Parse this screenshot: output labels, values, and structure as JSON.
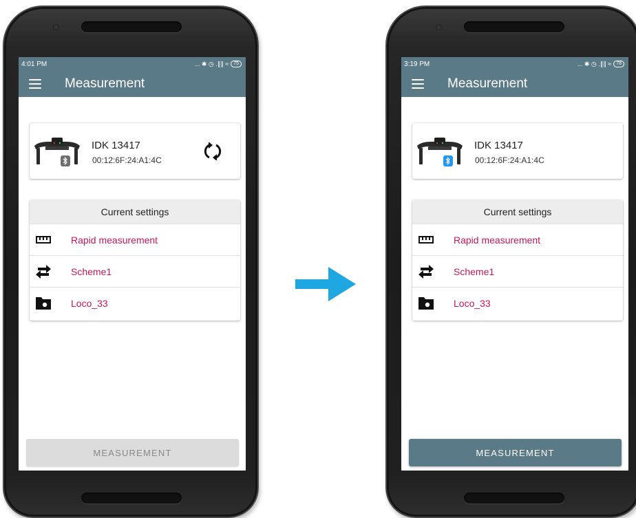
{
  "colors": {
    "appbar": "#5b7a87",
    "accent_text": "#c2185b",
    "arrow": "#1ea7e1",
    "bluetooth_inactive": "#6f6f6f",
    "bluetooth_active": "#2196f3",
    "button_disabled": "#dcdcdc",
    "button_enabled": "#5b7a87"
  },
  "arrow": {
    "icon": "right-arrow-icon",
    "meaning": ""
  },
  "phones": [
    {
      "state": "disconnected",
      "status_bar": {
        "time": "4:01 PM",
        "battery": "75",
        "icons": "... ✱ ◷ .∥∥ ≈"
      },
      "app_bar": {
        "title": "Measurement",
        "menu_icon": "hamburger-menu-icon"
      },
      "device": {
        "name": "IDK 13417",
        "mac": "00:12:6F:24:A1:4C",
        "bluetooth_connected": false,
        "show_refresh": true
      },
      "settings": {
        "header": "Current settings",
        "items": [
          {
            "label": "Rapid measurement",
            "icon": "ruler-icon"
          },
          {
            "label": "Scheme1",
            "icon": "swap-arrows-icon"
          },
          {
            "label": "Loco_33",
            "icon": "folder-camera-icon"
          }
        ]
      },
      "button": {
        "label": "MEASUREMENT",
        "enabled": false
      }
    },
    {
      "state": "connected",
      "status_bar": {
        "time": "3:19 PM",
        "battery": "78",
        "icons": "... ✱ ◷ .∥∥ ≈"
      },
      "app_bar": {
        "title": "Measurement",
        "menu_icon": "hamburger-menu-icon"
      },
      "device": {
        "name": "IDK 13417",
        "mac": "00:12:6F:24:A1:4C",
        "bluetooth_connected": true,
        "show_refresh": false
      },
      "settings": {
        "header": "Current settings",
        "items": [
          {
            "label": "Rapid measurement",
            "icon": "ruler-icon"
          },
          {
            "label": "Scheme1",
            "icon": "swap-arrows-icon"
          },
          {
            "label": "Loco_33",
            "icon": "folder-camera-icon"
          }
        ]
      },
      "button": {
        "label": "MEASUREMENT",
        "enabled": true
      }
    }
  ]
}
